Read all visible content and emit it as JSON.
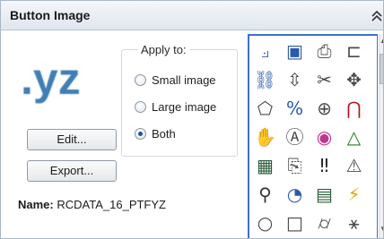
{
  "panel": {
    "title": "Button Image"
  },
  "preview": {
    "text": ".yz",
    "color": "#3f7fb5"
  },
  "apply_to": {
    "legend": "Apply to:",
    "options": [
      {
        "label": "Small image",
        "checked": false
      },
      {
        "label": "Large image",
        "checked": false
      },
      {
        "label": "Both",
        "checked": true
      }
    ]
  },
  "buttons": {
    "edit_label": "Edit...",
    "export_label": "Export..."
  },
  "name": {
    "label": "Name:",
    "value": "RCDATA_16_PTFYZ"
  },
  "gallery": {
    "selection_color": "#3b73c8",
    "icons": [
      {
        "name": "axis-3d-icon",
        "glyph": "⟓",
        "color": "#4a6fa5"
      },
      {
        "name": "cube-hand-icon",
        "glyph": "▣",
        "color": "#2a5aa8"
      },
      {
        "name": "document-stamp-icon",
        "glyph": "⎙",
        "color": "#555555"
      },
      {
        "name": "corner-bracket-icon",
        "glyph": "⊏",
        "color": "#4a4a4a"
      },
      {
        "name": "link-chain-icon",
        "glyph": "⛓",
        "color": "#2a5aa8"
      },
      {
        "name": "move-arrows-icon",
        "glyph": "⇳",
        "color": "#4a4a4a"
      },
      {
        "name": "scissors-shape-icon",
        "glyph": "✂",
        "color": "#4a4a4a"
      },
      {
        "name": "ucs-move-icon",
        "glyph": "✥",
        "color": "#4a4a4a"
      },
      {
        "name": "shape-edit-icon",
        "glyph": "⬠",
        "color": "#4a4a4a"
      },
      {
        "name": "percent-pencil-icon",
        "glyph": "%",
        "color": "#2a5aa8"
      },
      {
        "name": "compass-circle-icon",
        "glyph": "⊕",
        "color": "#4a4a4a"
      },
      {
        "name": "magnet-icon",
        "glyph": "⋂",
        "color": "#b5121b"
      },
      {
        "name": "pan-hand-icon",
        "glyph": "✋",
        "color": "#4a4a4a"
      },
      {
        "name": "text-frame-icon",
        "glyph": "Ⓐ",
        "color": "#4a4a4a"
      },
      {
        "name": "globe-color-icon",
        "glyph": "◉",
        "color": "#c0358f"
      },
      {
        "name": "triangle-tool-icon",
        "glyph": "△",
        "color": "#2a7a2a"
      },
      {
        "name": "data-grid-icon",
        "glyph": "▦",
        "color": "#2a5a3a"
      },
      {
        "name": "document-link-icon",
        "glyph": "⎘",
        "color": "#555555"
      },
      {
        "name": "exclamation-double-icon",
        "glyph": "‼",
        "color": "#222222"
      },
      {
        "name": "snap-warning-icon",
        "glyph": "⚠",
        "color": "#4a4a4a"
      },
      {
        "name": "zoom-search-icon",
        "glyph": "⚲",
        "color": "#333333"
      },
      {
        "name": "color-wheel-icon",
        "glyph": "◔",
        "color": "#2a5aa8"
      },
      {
        "name": "grid-table-icon",
        "glyph": "▤",
        "color": "#2a5a3a"
      },
      {
        "name": "lightning-icon",
        "glyph": "⚡",
        "color": "#e0a800"
      },
      {
        "name": "circle-outline-icon",
        "glyph": "○",
        "color": "#4a4a4a"
      },
      {
        "name": "square-outline-icon",
        "glyph": "□",
        "color": "#4a4a4a"
      },
      {
        "name": "cylinder-icon",
        "glyph": "⌭",
        "color": "#4a4a4a"
      },
      {
        "name": "person-move-icon",
        "glyph": "⚹",
        "color": "#4a4a4a"
      }
    ]
  }
}
